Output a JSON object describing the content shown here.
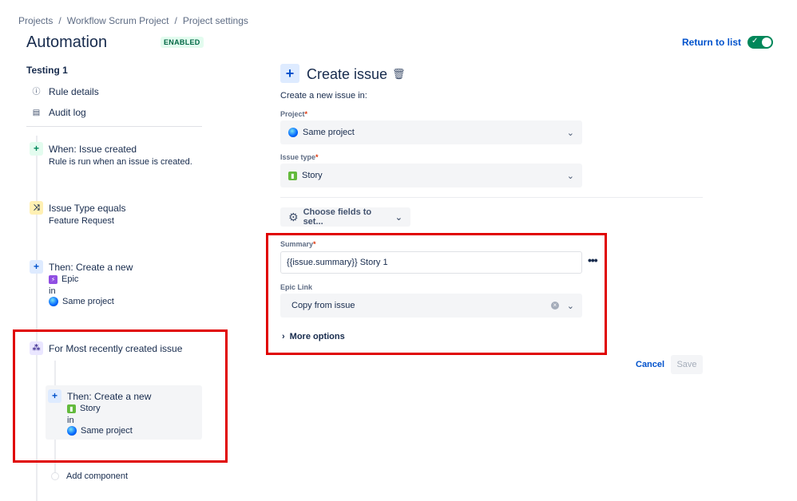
{
  "breadcrumb": [
    "Projects",
    "Workflow Scrum Project",
    "Project settings"
  ],
  "breadcrumb_sep": "/",
  "page": {
    "title": "Automation",
    "status_badge": "ENABLED",
    "return_link": "Return to list",
    "rule_enabled": true
  },
  "sidebar": {
    "rule_name": "Testing 1",
    "links": [
      {
        "label": "Rule details",
        "icon": "info-icon"
      },
      {
        "label": "Audit log",
        "icon": "document-icon"
      }
    ]
  },
  "components": {
    "trigger": {
      "title": "When: Issue created",
      "subtitle": "Rule is run when an issue is created."
    },
    "condition": {
      "title": "Issue Type equals",
      "subtitle": "Feature Request"
    },
    "action": {
      "title": "Then: Create a new",
      "issue_type": "Epic",
      "in": "in",
      "project": "Same project"
    },
    "branch": {
      "title": "For Most recently created issue",
      "nested": {
        "title": "Then: Create a new",
        "issue_type": "Story",
        "in": "in",
        "project": "Same project"
      }
    },
    "add_component": "Add component"
  },
  "editor": {
    "title": "Create issue",
    "hint": "Create a new issue in:",
    "project": {
      "label": "Project",
      "value": "Same project"
    },
    "issue_type": {
      "label": "Issue type",
      "value": "Story"
    },
    "choose_fields": "Choose fields to set...",
    "summary": {
      "label": "Summary",
      "value": "{{issue.summary}} Story 1"
    },
    "epic_link": {
      "label": "Epic Link",
      "value": "Copy from issue"
    },
    "more_options": "More options",
    "cancel": "Cancel",
    "save": "Save"
  },
  "colors": {
    "accent": "#0052cc",
    "toggle_on": "#00875a",
    "highlight": "#e00000",
    "epic": "#904ee2",
    "story": "#63ba3c"
  }
}
